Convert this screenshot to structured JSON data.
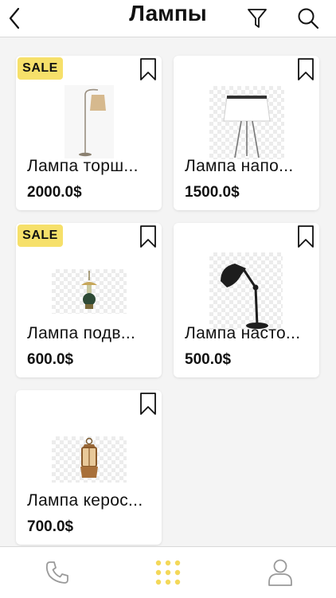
{
  "header": {
    "title": "Лампы"
  },
  "products": [
    {
      "name": "Лампа торш...",
      "price": "2000.0$",
      "badge": "SALE",
      "image_icon": "floor-lamp-icon"
    },
    {
      "name": "Лампа напо...",
      "price": "1500.0$",
      "badge": "",
      "image_icon": "tripod-lamp-icon"
    },
    {
      "name": "Лампа подв...",
      "price": "600.0$",
      "badge": "SALE",
      "image_icon": "pendant-lamp-icon"
    },
    {
      "name": "Лампа насто...",
      "price": "500.0$",
      "badge": "",
      "image_icon": "desk-lamp-icon"
    },
    {
      "name": "Лампа керос...",
      "price": "700.0$",
      "badge": "",
      "image_icon": "kerosene-lamp-icon"
    }
  ],
  "tabbar": {
    "items": [
      {
        "icon": "phone-icon",
        "active": false
      },
      {
        "icon": "grid-icon",
        "active": true
      },
      {
        "icon": "user-icon",
        "active": false
      }
    ]
  },
  "colors": {
    "sale_badge": "#f6e06a",
    "active_tab": "#f3d85a",
    "inactive_tab": "#9a9a9a"
  }
}
